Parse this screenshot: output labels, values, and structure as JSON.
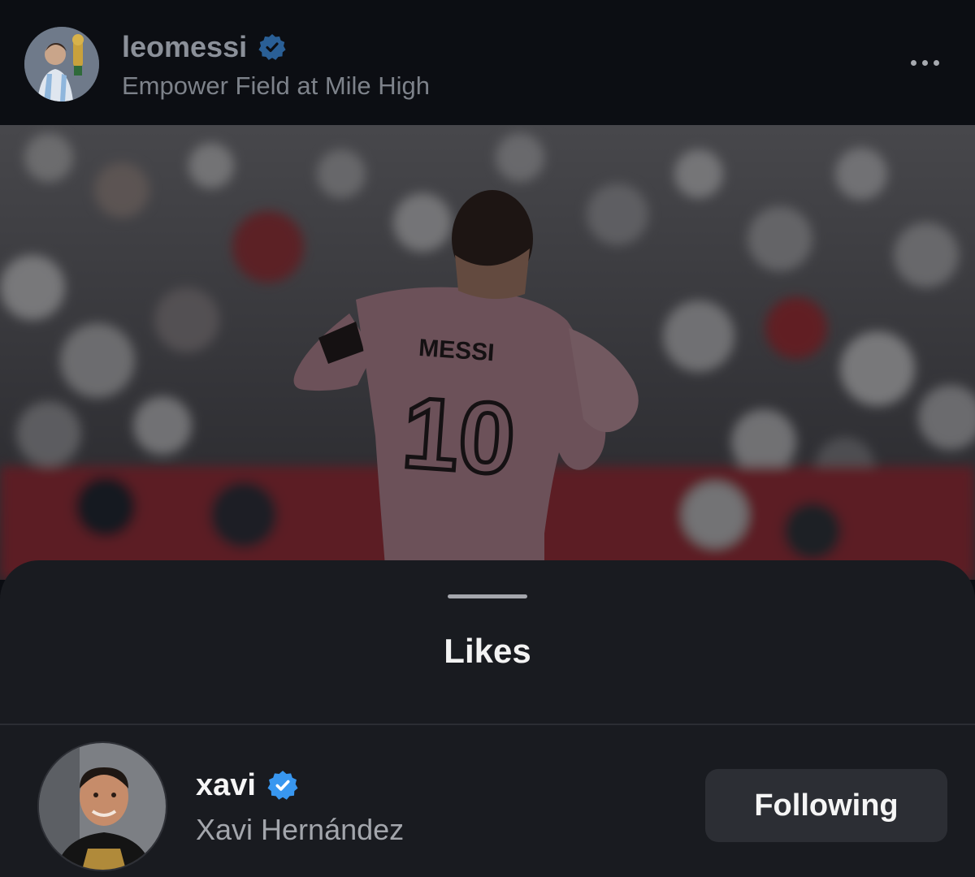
{
  "post": {
    "username": "leomessi",
    "location": "Empower Field at Mile High",
    "verified_icon": "verified-badge-icon",
    "more_icon": "more-horizontal-icon",
    "photo": {
      "jersey_name": "MESSI",
      "jersey_number": "10"
    }
  },
  "likes_sheet": {
    "title": "Likes",
    "users": [
      {
        "username": "xavi",
        "full_name": "Xavi Hernández",
        "verified": true,
        "button_label": "Following"
      }
    ]
  },
  "colors": {
    "verified_blue": "#3897f0",
    "verified_blue_dimmed": "#2a5f96",
    "jersey_pink": "#d9a3b2",
    "sheet_background": "#191b20",
    "button_background": "#2c2e34"
  }
}
